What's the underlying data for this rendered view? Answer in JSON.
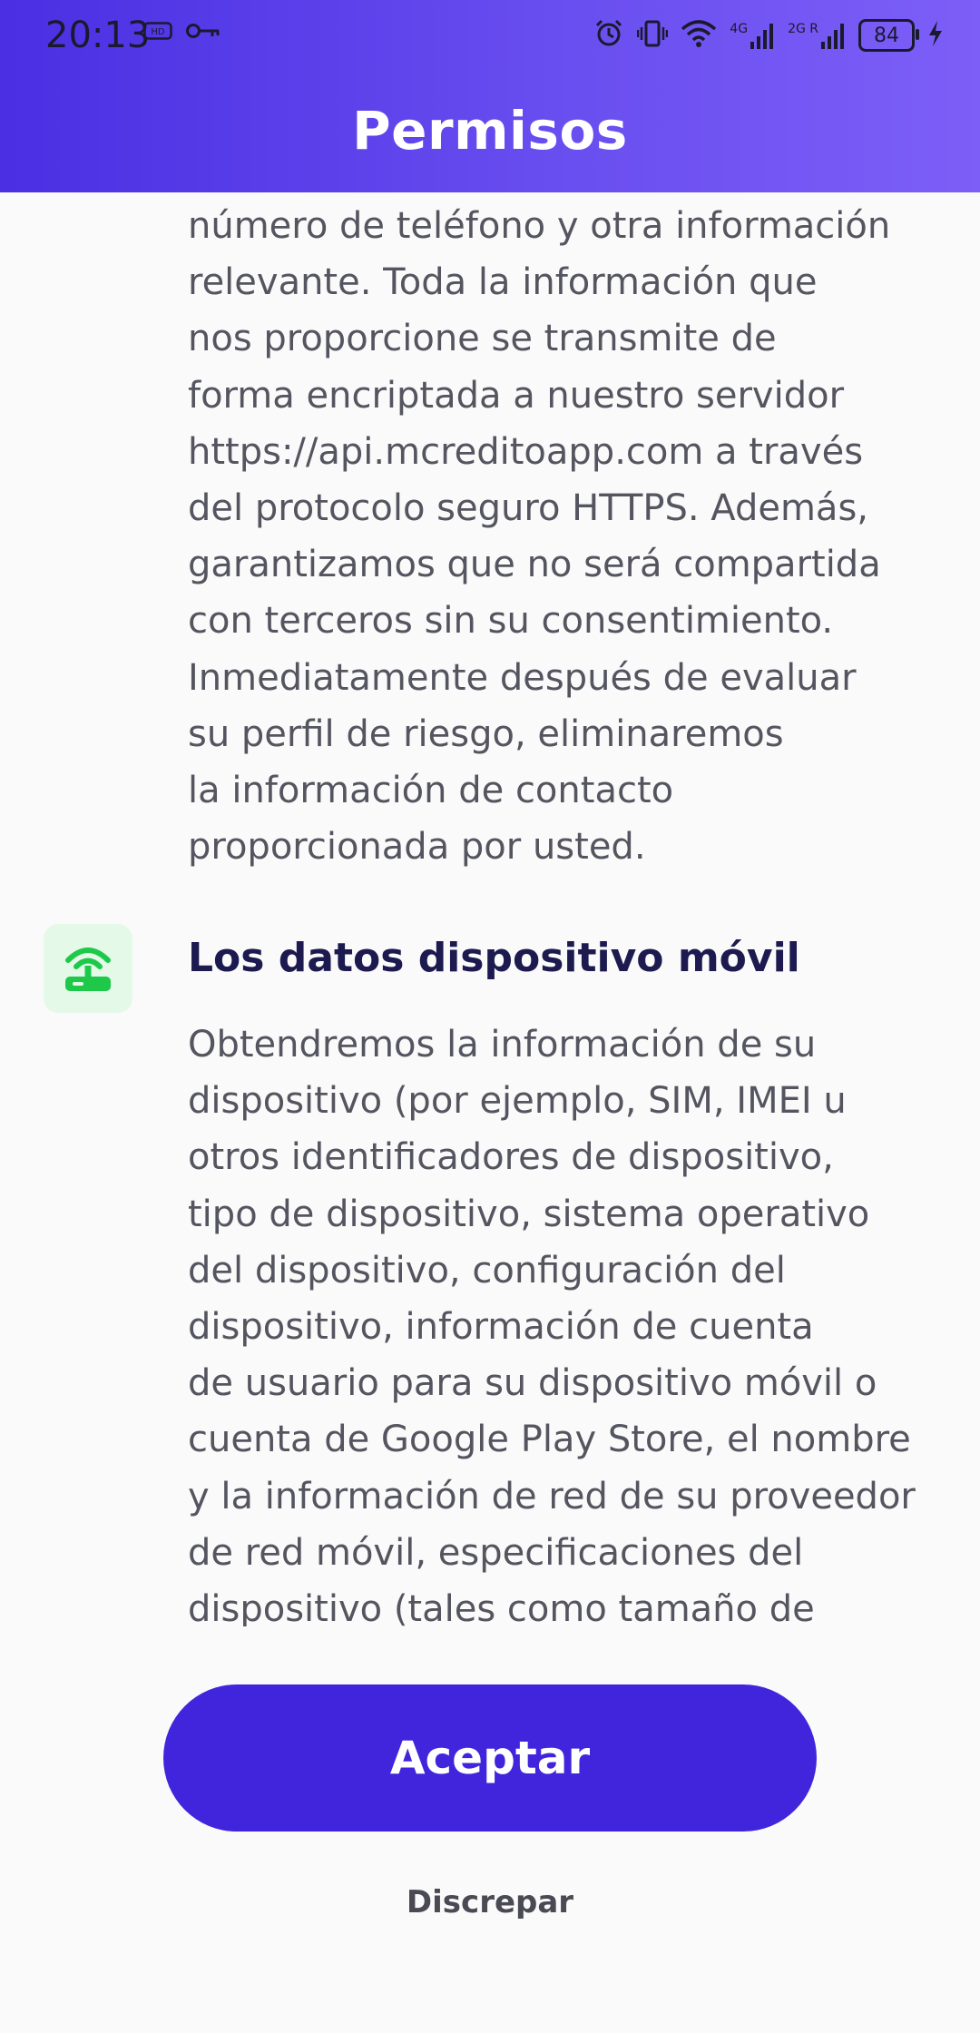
{
  "status_bar": {
    "time": "20:13",
    "network_1": "4G",
    "network_2": "2G R",
    "battery": "84",
    "icons": [
      "hd-icon",
      "key-icon",
      "alarm-icon",
      "vibrate-icon",
      "wifi-icon",
      "signal-icon",
      "signal-icon",
      "battery-icon",
      "charging-icon"
    ]
  },
  "header": {
    "title": "Permisos",
    "gradient": [
      "#4a2fe3",
      "#7d5ef7"
    ]
  },
  "content": {
    "paragraph_1_lines": [
      "número de teléfono y otra información",
      "relevante. Toda la información que",
      "nos proporcione se transmite de",
      "forma encriptada a nuestro servidor",
      "https://api.mcreditoapp.com a través",
      "del protocolo seguro HTTPS. Además,",
      "garantizamos que no será compartida",
      "con terceros sin su consentimiento.",
      "Inmediatamente después de evaluar",
      "su perfil de riesgo, eliminaremos",
      "la información de contacto",
      "proporcionada por usted."
    ],
    "section": {
      "icon": "router-icon",
      "icon_color": "#1ec94a",
      "title": "Los datos dispositivo móvil",
      "lines": [
        "Obtendremos la información de su",
        "dispositivo (por ejemplo, SIM, IMEI u",
        "otros identificadores de dispositivo,",
        "tipo de dispositivo, sistema operativo",
        "del dispositivo, configuración del",
        "dispositivo, información de cuenta",
        "de usuario para su dispositivo móvil o",
        "cuenta de Google Play Store, el nombre",
        "y la información de red de su proveedor",
        "de red móvil, especificaciones del",
        "dispositivo (tales como tamaño de"
      ]
    }
  },
  "actions": {
    "accept_label": "Aceptar",
    "decline_label": "Discrepar",
    "accent_color": "#4125dd"
  }
}
